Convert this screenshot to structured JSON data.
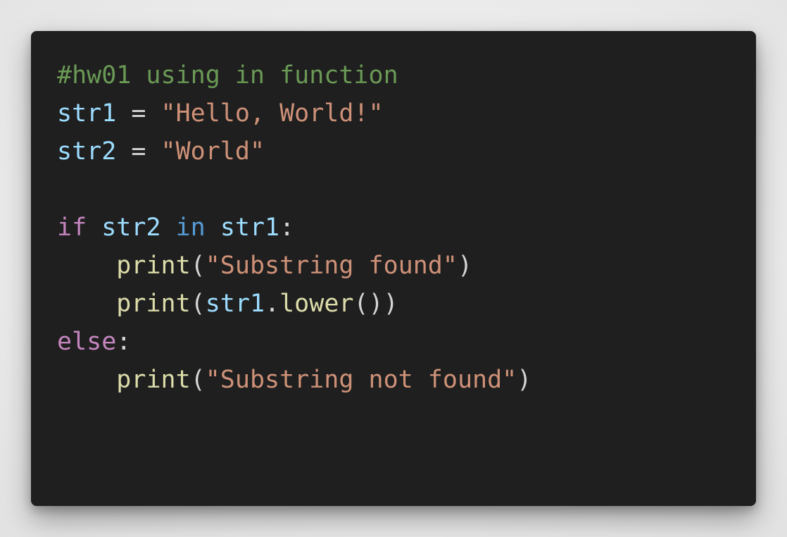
{
  "colors": {
    "background": "#ececec",
    "editor_background": "#1f1f1f",
    "comment": "#6a9955",
    "variable": "#9cdcfe",
    "string": "#ce9178",
    "keyword_control": "#c586c0",
    "keyword_operator": "#569cd6",
    "function": "#dcdcaa",
    "default_text": "#d4d4d4"
  },
  "code": {
    "language": "python",
    "line1": {
      "comment": "#hw01 using in function"
    },
    "line2": {
      "var": "str1",
      "op": " = ",
      "str": "\"Hello, World!\""
    },
    "line3": {
      "var": "str2",
      "op": " = ",
      "str": "\"World\""
    },
    "line5": {
      "kw": "if",
      "sp1": " ",
      "var1": "str2",
      "sp2": " ",
      "kw2": "in",
      "sp3": " ",
      "var2": "str1",
      "punc": ":"
    },
    "line6": {
      "indent": "    ",
      "fn": "print",
      "open": "(",
      "str": "\"Substring found\"",
      "close": ")"
    },
    "line7": {
      "indent": "    ",
      "fn": "print",
      "open": "(",
      "var": "str1",
      "dot": ".",
      "method": "lower",
      "close": "())"
    },
    "line8": {
      "kw": "else",
      "punc": ":"
    },
    "line9": {
      "indent": "    ",
      "fn": "print",
      "open": "(",
      "str": "\"Substring not found\"",
      "close": ")"
    }
  }
}
